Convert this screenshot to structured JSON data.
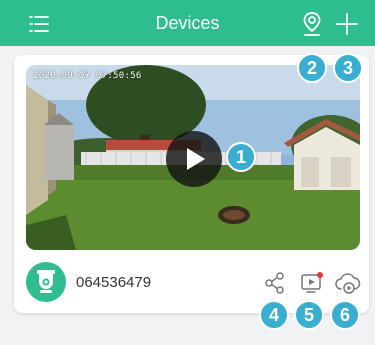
{
  "header": {
    "title": "Devices",
    "menu_icon": "menu-icon",
    "location_icon": "location-pin-icon",
    "add_icon": "plus-icon"
  },
  "device": {
    "name": "064536479",
    "timestamp": "2020-09-07 07:50:56",
    "avatar_icon": "security-camera-icon"
  },
  "actions": {
    "share_icon": "share-icon",
    "playback_icon": "playback-icon",
    "cloud_icon": "cloud-play-icon"
  },
  "badges": [
    "1",
    "2",
    "3",
    "4",
    "5",
    "6"
  ],
  "colors": {
    "accent": "#2ebd8f",
    "badge": "#3aaed0",
    "notification": "#e53935"
  }
}
